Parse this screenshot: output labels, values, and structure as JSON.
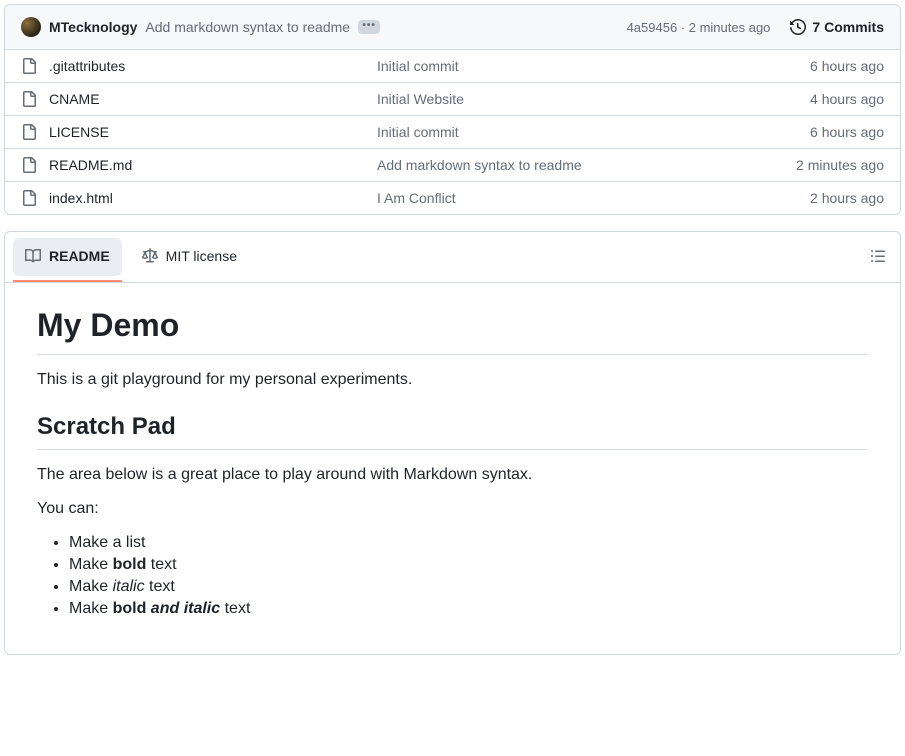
{
  "commit": {
    "author": "MTecknology",
    "message": "Add markdown syntax to readme",
    "sha": "4a59456",
    "time": "2 minutes ago",
    "separator": " · ",
    "commits_label": "7 Commits",
    "ellipsis": "•••"
  },
  "files": [
    {
      "name": ".gitattributes",
      "message": "Initial commit",
      "time": "6 hours ago"
    },
    {
      "name": "CNAME",
      "message": "Initial Website",
      "time": "4 hours ago"
    },
    {
      "name": "LICENSE",
      "message": "Initial commit",
      "time": "6 hours ago"
    },
    {
      "name": "README.md",
      "message": "Add markdown syntax to readme",
      "time": "2 minutes ago"
    },
    {
      "name": "index.html",
      "message": "I Am Conflict",
      "time": "2 hours ago"
    }
  ],
  "tabs": {
    "readme": "README",
    "license": "MIT license"
  },
  "readme": {
    "h1": "My Demo",
    "p1": "This is a git playground for my personal experiments.",
    "h2": "Scratch Pad",
    "p2": "The area below is a great place to play around with Markdown syntax.",
    "p3": "You can:",
    "li1": "Make a list",
    "li2_pre": "Make ",
    "li2_bold": "bold",
    "li2_post": " text",
    "li3_pre": "Make ",
    "li3_italic": "italic",
    "li3_post": " text",
    "li4_pre": "Make ",
    "li4_bold1": "bold ",
    "li4_bi": "and italic",
    "li4_post": " text"
  }
}
